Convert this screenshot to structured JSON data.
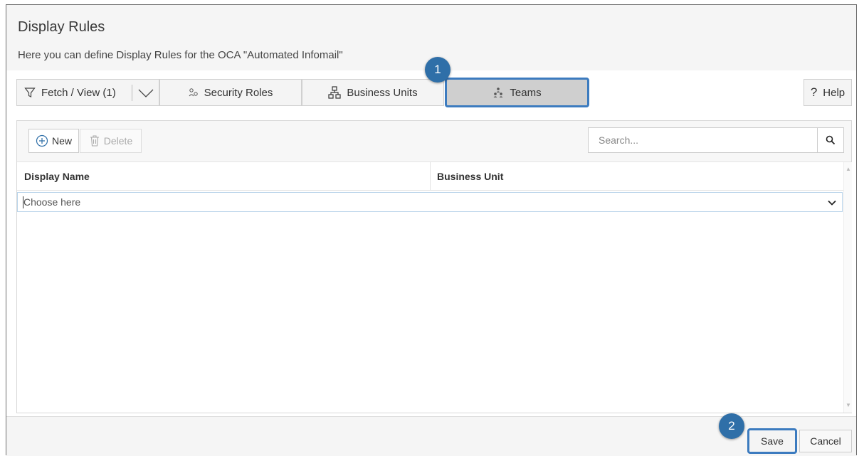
{
  "dialog": {
    "title": "Display Rules",
    "subtitle": "Here you can define Display Rules for the OCA \"Automated Infomail\""
  },
  "tabs": {
    "fetch_view": {
      "label": "Fetch / View (1)",
      "icon": "funnel-icon"
    },
    "security_roles": {
      "label": "Security Roles",
      "icon": "security-roles-icon"
    },
    "business_units": {
      "label": "Business Units",
      "icon": "business-units-icon"
    },
    "teams": {
      "label": "Teams",
      "icon": "teams-icon",
      "selected": true
    },
    "help": {
      "label": "Help",
      "glyph": "?"
    }
  },
  "callouts": {
    "first": "1",
    "second": "2"
  },
  "toolbar": {
    "new_label": "New",
    "delete_label": "Delete",
    "search_placeholder": "Search..."
  },
  "grid": {
    "columns": [
      "Display Name",
      "Business Unit"
    ],
    "selector_placeholder": "Choose here"
  },
  "footer": {
    "save_label": "Save",
    "cancel_label": "Cancel"
  },
  "colors": {
    "highlight": "#3c7bbf",
    "callout": "#2f6fa8",
    "selected_tab": "#cfcfcf"
  }
}
